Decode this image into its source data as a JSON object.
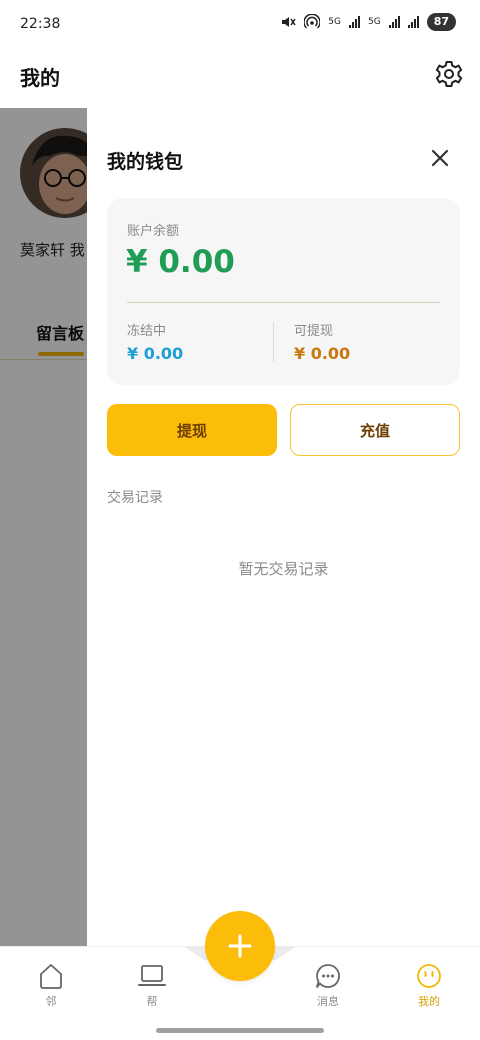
{
  "status_bar": {
    "time": "22:38",
    "network_1": "5G",
    "network_2": "5G",
    "battery": "87",
    "icons": [
      "mute-vibrate-icon",
      "hotspot-icon",
      "signal-icon",
      "signal-icon",
      "signal-icon"
    ]
  },
  "header": {
    "title": "我的",
    "settings_icon": "gear-icon"
  },
  "profile": {
    "name_visible": "莫家轩 我",
    "tab_label": "留言板"
  },
  "wallet": {
    "title": "我的钱包",
    "close_icon": "close-icon",
    "balance_label": "账户余额",
    "balance_value": "¥ 0.00",
    "frozen_label": "冻结中",
    "frozen_value": "¥ 0.00",
    "available_label": "可提现",
    "available_value": "¥ 0.00",
    "withdraw_button": "提现",
    "recharge_button": "充值",
    "transactions_title": "交易记录",
    "transactions_empty": "暂无交易记录"
  },
  "bottom_nav": {
    "items": [
      {
        "label": "邻",
        "icon": "home-icon",
        "active": false
      },
      {
        "label": "帮",
        "icon": "laptop-icon",
        "active": false
      },
      {
        "label": "消息",
        "icon": "chat-bubble-icon",
        "active": false
      },
      {
        "label": "我的",
        "icon": "smiley-face-icon",
        "active": true
      }
    ],
    "fab_icon": "plus-icon"
  },
  "colors": {
    "accent": "#fbbd0a",
    "balance_green": "#1f9d55",
    "frozen_blue": "#1e9fd6",
    "available_orange": "#c9780f"
  }
}
